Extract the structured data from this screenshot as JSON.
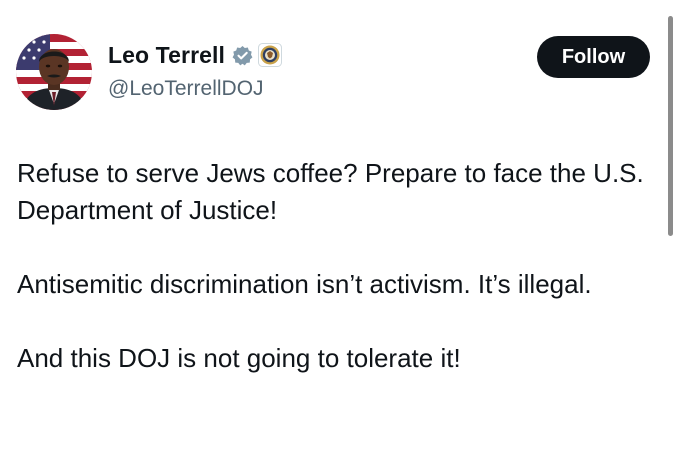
{
  "author": {
    "display_name": "Leo Terrell",
    "handle": "@LeoTerrellDOJ",
    "verified_icon": "verified-badge-icon",
    "affiliation_icon": "doj-seal-icon"
  },
  "actions": {
    "follow_label": "Follow"
  },
  "post": {
    "paragraphs": [
      "Refuse to serve Jews coffee? Prepare to face the U.S. Department of Justice!",
      "Antisemitic discrimination isn’t activism. It’s illegal.",
      "And this DOJ is not going to tolerate it!"
    ]
  },
  "colors": {
    "text": "#0f1419",
    "secondary": "#536471",
    "follow_bg": "#0f1419",
    "badge": "#829aab"
  }
}
